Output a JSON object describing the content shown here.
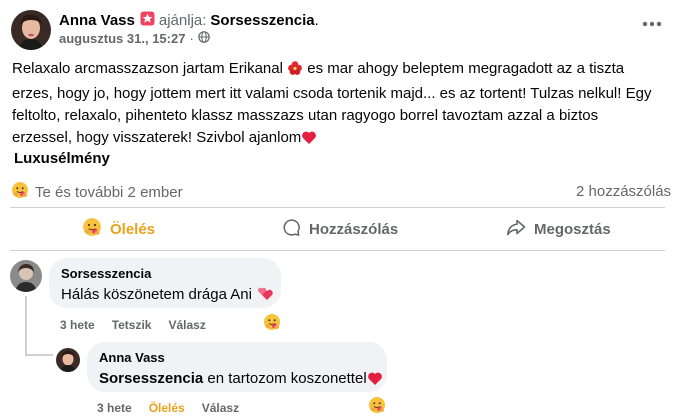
{
  "post": {
    "author": "Anna Vass",
    "recommends_text": "ajánlja:",
    "page_name": "Sorsesszencia",
    "dot": ".",
    "timestamp": "augusztus 31., 15:27",
    "meta_sep": "·",
    "privacy_icon": "globe-icon",
    "more_icon": "more-horizontal-icon",
    "text_part1": "Relaxalo arcmasszazson jartam Erikanal ",
    "text_part2": " es mar ahogy beleptem megragadott az a tiszta erzes, hogy jo, hogy jottem mert itt valami csoda tortenik majd... es az tortent! Tulzas nelkul! Egy feltolto, relaxalo, pihenteto klassz masszazs utan  ragyogo borrel tavoztam azzal a biztos erzessel, hogy visszaterek! Szivbol ajanlom",
    "section_title": "Luxusélmény"
  },
  "reactions": {
    "summary": "Te és további 2 ember",
    "comments_count": "2 hozzászólás"
  },
  "actions": {
    "hug": "Ölelés",
    "comment": "Hozzászólás",
    "share": "Megosztás"
  },
  "comments": [
    {
      "author": "Sorsesszencia",
      "text": "Hálás köszönetem drága Ani",
      "time": "3 hete",
      "like": "Tetszik",
      "reply": "Válasz"
    },
    {
      "author": "Anna Vass",
      "mention": "Sorsesszencia",
      "text": " en tartozom koszonettel",
      "time": "3 hete",
      "like": "Ölelés",
      "reply": "Válasz"
    }
  ],
  "colors": {
    "accent_hug": "#e9a219",
    "recommend_badge": "#f3425f",
    "heart": "#e41e3f",
    "secondary_text": "#65676b",
    "bubble_bg": "#f0f2f5"
  }
}
